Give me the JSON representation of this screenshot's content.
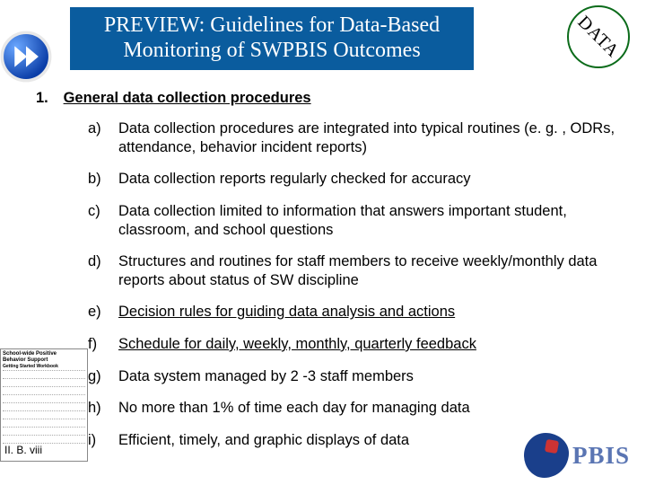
{
  "title": "PREVIEW: Guidelines for Data-Based Monitoring of SWPBIS Outcomes",
  "badge": "DATA",
  "main": {
    "number": "1.",
    "heading": "General data collection procedures"
  },
  "items": [
    {
      "marker": "a)",
      "text": "Data collection procedures are integrated into typical routines (e. g. , ODRs, attendance, behavior incident reports)",
      "underline": false
    },
    {
      "marker": "b)",
      "text": "Data collection reports regularly checked for accuracy",
      "underline": false
    },
    {
      "marker": "c)",
      "text": "Data collection limited to information that answers important student, classroom, and school questions",
      "underline": false
    },
    {
      "marker": "d)",
      "text": "Structures and routines for staff members to receive weekly/monthly data reports about status of SW discipline",
      "underline": false
    },
    {
      "marker": "e)",
      "text": "Decision rules for guiding data analysis and actions",
      "underline": true
    },
    {
      "marker": "f)",
      "text": "Schedule for daily, weekly, monthly, quarterly feedback",
      "underline": true
    },
    {
      "marker": "g)",
      "text": "Data system managed by 2 -3 staff members",
      "underline": false
    },
    {
      "marker": "h)",
      "text": "No more than 1% of time each day for managing data",
      "underline": false
    },
    {
      "marker": "i)",
      "text": "Efficient, timely, and graphic displays of data",
      "underline": false
    }
  ],
  "thumbnail": {
    "line1": "School-wide Positive",
    "line2": "Behavior Support",
    "line3": "Getting Started Workbook",
    "ref": "II. B. viii"
  },
  "logo_text": "PBIS"
}
